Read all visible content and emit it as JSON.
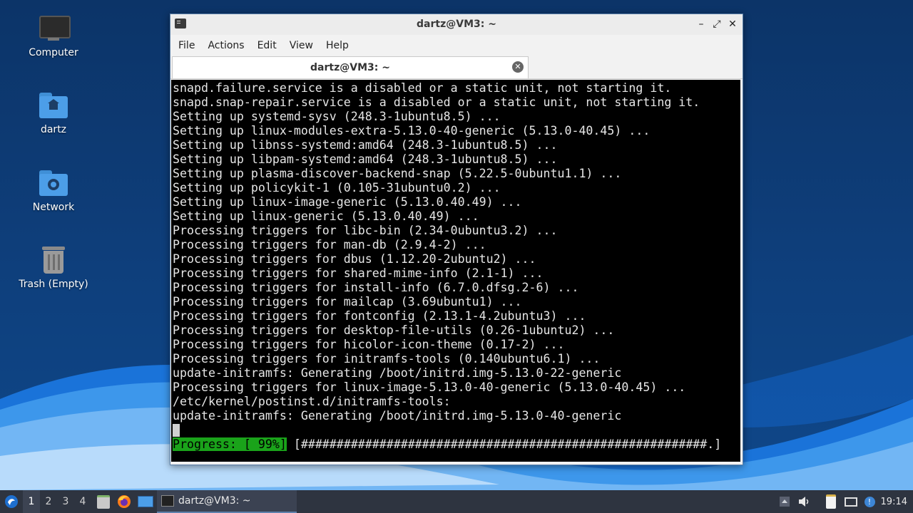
{
  "desktop": {
    "icons": [
      {
        "label": "Computer",
        "icon": "computer-icon"
      },
      {
        "label": "dartz",
        "icon": "home-folder-icon"
      },
      {
        "label": "Network",
        "icon": "network-folder-icon"
      },
      {
        "label": "Trash (Empty)",
        "icon": "trash-icon"
      }
    ]
  },
  "window": {
    "title": "dartz@VM3: ~",
    "buttons": {
      "minimize": "–",
      "maximize": "⤢",
      "close": "✕"
    },
    "menu": [
      "File",
      "Actions",
      "Edit",
      "View",
      "Help"
    ],
    "tab": {
      "label": "dartz@VM3: ~",
      "close": "✕"
    }
  },
  "terminal": {
    "lines": [
      "snapd.failure.service is a disabled or a static unit, not starting it.",
      "snapd.snap-repair.service is a disabled or a static unit, not starting it.",
      "Setting up systemd-sysv (248.3-1ubuntu8.5) ...",
      "Setting up linux-modules-extra-5.13.0-40-generic (5.13.0-40.45) ...",
      "Setting up libnss-systemd:amd64 (248.3-1ubuntu8.5) ...",
      "Setting up libpam-systemd:amd64 (248.3-1ubuntu8.5) ...",
      "Setting up plasma-discover-backend-snap (5.22.5-0ubuntu1.1) ...",
      "Setting up policykit-1 (0.105-31ubuntu0.2) ...",
      "Setting up linux-image-generic (5.13.0.40.49) ...",
      "Setting up linux-generic (5.13.0.40.49) ...",
      "Processing triggers for libc-bin (2.34-0ubuntu3.2) ...",
      "Processing triggers for man-db (2.9.4-2) ...",
      "Processing triggers for dbus (1.12.20-2ubuntu2) ...",
      "Processing triggers for shared-mime-info (2.1-1) ...",
      "Processing triggers for install-info (6.7.0.dfsg.2-6) ...",
      "Processing triggers for mailcap (3.69ubuntu1) ...",
      "Processing triggers for fontconfig (2.13.1-4.2ubuntu3) ...",
      "Processing triggers for desktop-file-utils (0.26-1ubuntu2) ...",
      "Processing triggers for hicolor-icon-theme (0.17-2) ...",
      "Processing triggers for initramfs-tools (0.140ubuntu6.1) ...",
      "update-initramfs: Generating /boot/initrd.img-5.13.0-22-generic",
      "Processing triggers for linux-image-5.13.0-40-generic (5.13.0-40.45) ...",
      "/etc/kernel/postinst.d/initramfs-tools:",
      "update-initramfs: Generating /boot/initrd.img-5.13.0-40-generic"
    ],
    "progress_label": "Progress: [ 99%]",
    "progress_bar": " [#########################################################.]"
  },
  "taskbar": {
    "workspaces": [
      "1",
      "2",
      "3",
      "4"
    ],
    "active_workspace": "1",
    "task_label": "dartz@VM3: ~",
    "clock": "19:14"
  },
  "colors": {
    "progress_bg": "#1aa31a",
    "desktop_bg": "#0d3a73",
    "taskbar_bg": "#2e3440"
  }
}
